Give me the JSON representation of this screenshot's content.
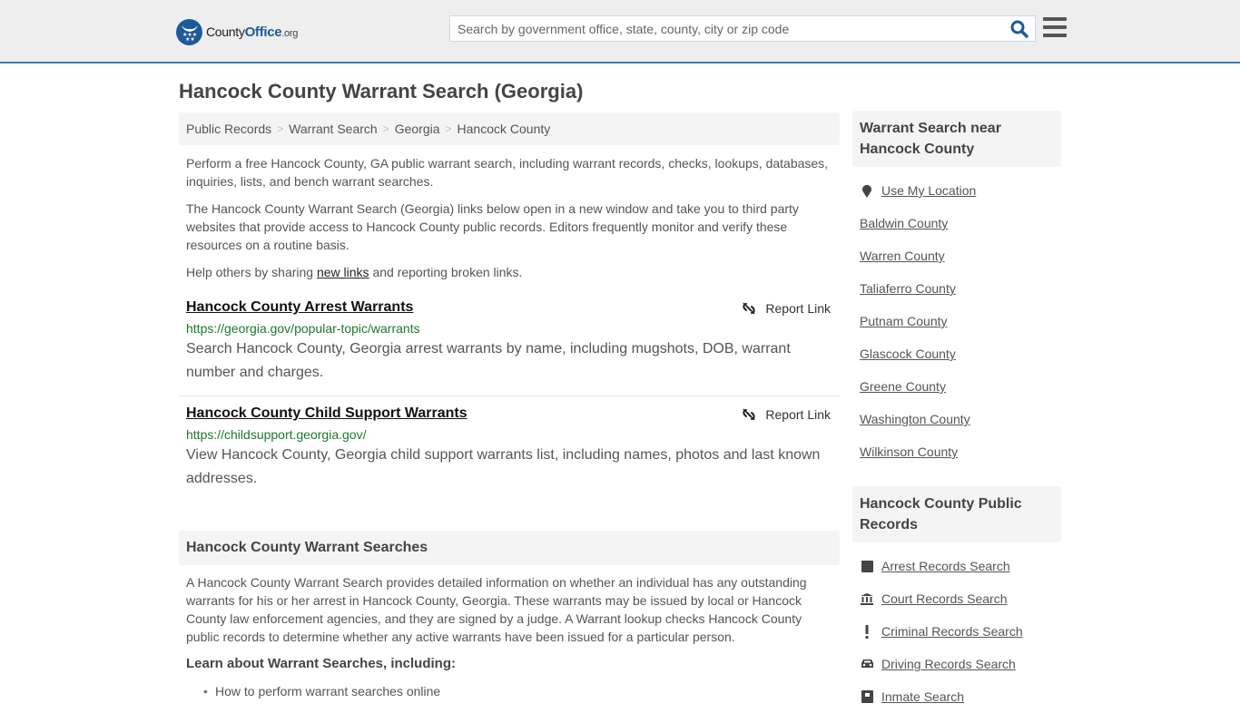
{
  "header": {
    "logo": {
      "name": "County",
      "name_bold": "Office",
      "tld": ".org"
    },
    "search": {
      "placeholder": "Search by government office, state, county, city or zip code",
      "value": ""
    },
    "colors": {
      "brand": "#1d5a9a",
      "header_border": "#3a7cad"
    }
  },
  "page": {
    "title": "Hancock County Warrant Search (Georgia)",
    "breadcrumb": [
      "Public Records",
      "Warrant Search",
      "Georgia",
      "Hancock County"
    ],
    "intro": {
      "p1": "Perform a free Hancock County, GA public warrant search, including warrant records, checks, lookups, databases, inquiries, lists, and bench warrant searches.",
      "p2": "The Hancock County Warrant Search (Georgia) links below open in a new window and take you to third party websites that provide access to Hancock County public records. Editors frequently monitor and verify these resources on a routine basis.",
      "p3_before": "Help others by sharing ",
      "p3_link": "new links",
      "p3_after": " and reporting broken links."
    },
    "links": [
      {
        "title": "Hancock County Arrest Warrants",
        "url": "https://georgia.gov/popular-topic/warrants",
        "description": "Search Hancock County, Georgia arrest warrants by name, including mugshots, DOB, warrant number and charges.",
        "report_label": "Report Link"
      },
      {
        "title": "Hancock County Child Support Warrants",
        "url": "https://childsupport.georgia.gov/",
        "description": "View Hancock County, Georgia child support warrants list, including names, photos and last known addresses.",
        "report_label": "Report Link"
      }
    ],
    "section": {
      "heading": "Hancock County Warrant Searches",
      "body": "A Hancock County Warrant Search provides detailed information on whether an individual has any outstanding warrants for his or her arrest in Hancock County, Georgia. These warrants may be issued by local or Hancock County law enforcement agencies, and they are signed by a judge. A Warrant lookup checks Hancock County public records to determine whether any active warrants have been issued for a particular person.",
      "learn_heading": "Learn about Warrant Searches, including:",
      "learn_items": [
        "How to perform warrant searches online"
      ]
    }
  },
  "sidebar": {
    "nearby": {
      "heading": "Warrant Search near Hancock County",
      "use_location": "Use My Location",
      "counties": [
        "Baldwin County",
        "Warren County",
        "Taliaferro County",
        "Putnam County",
        "Glascock County",
        "Greene County",
        "Washington County",
        "Wilkinson County"
      ]
    },
    "records": {
      "heading": "Hancock County Public Records",
      "items": [
        {
          "label": "Arrest Records Search",
          "icon": "square-icon"
        },
        {
          "label": "Court Records Search",
          "icon": "courthouse-icon"
        },
        {
          "label": "Criminal Records Search",
          "icon": "exclamation-icon"
        },
        {
          "label": "Driving Records Search",
          "icon": "car-icon"
        },
        {
          "label": "Inmate Search",
          "icon": "inmate-icon"
        }
      ]
    }
  }
}
